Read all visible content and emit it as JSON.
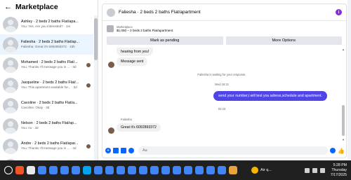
{
  "sidebar": {
    "title": "Marketplace",
    "conversations": [
      {
        "name": "Ashley · 2 beds 2 baths Flat/apa...",
        "preview": "You: Yes. Are you interested? · 1m",
        "active": false,
        "unread_avatar": false
      },
      {
        "name": "Faliesha · 2 beds 2 baths Flat/ap...",
        "preview": "Faliesha: Great it's 6092893372 · 15h",
        "active": true,
        "unread_avatar": false
      },
      {
        "name": "Mohamed · 2 beds 2 baths Flat/...",
        "preview": "You: Thanks I'll message you in ... · 3d",
        "active": false,
        "unread_avatar": true
      },
      {
        "name": "Jacqueline · 2 beds 2 baths Flat/...",
        "preview": "You: This apartment available for... · 3d",
        "active": false,
        "unread_avatar": true
      },
      {
        "name": "Cavoline · 2 beds 2 baths Flat/a...",
        "preview": "Cavoline: Okay · 3d",
        "active": false,
        "unread_avatar": false
      },
      {
        "name": "Nelson · 2 beds 2 baths Flat/ap...",
        "preview": "You: no · 3d",
        "active": false,
        "unread_avatar": false
      },
      {
        "name": "Andre · 2 beds 2 baths Flat/apar...",
        "preview": "You: Thanks I'll message you in ... · 4d",
        "active": false,
        "unread_avatar": true
      },
      {
        "name": "Lorena · 2 beds 2 baths Flat/apa...",
        "preview": "",
        "active": false,
        "unread_avatar": false
      }
    ]
  },
  "chat": {
    "title": "Faliesha · 2 beds 2 baths Flat/apartment",
    "listing": {
      "label": "Marketplace",
      "detail": "$1,050 – 2 beds 2 baths Flat/apartment"
    },
    "actions": {
      "mark_pending": "Mark as pending",
      "more_options": "More Options"
    },
    "messages": {
      "partial_in": "hearing from you!",
      "sent_in": "Message sent",
      "waiting": "Faliesha is waiting for your response.",
      "time_1": "Wed 18:31",
      "out_1": "send your number,i will text you adress,schedule and apartment.",
      "time_2": "02:23",
      "sender": "Faliesha",
      "in_2": "Great it's 6092893372"
    },
    "composer": {
      "placeholder": "Aa"
    }
  },
  "taskbar": {
    "weather": "Air q...",
    "time": "5:28 PM",
    "day": "Thursday",
    "date": "7/17/2025",
    "app_colors": [
      "#f35325",
      "#e8e8e8",
      "#4285f4",
      "#4285f4",
      "#4285f4",
      "#4285f4",
      "#00a4ef",
      "#4285f4",
      "#4285f4",
      "#4285f4",
      "#4285f4",
      "#4285f4",
      "#4285f4",
      "#4285f4",
      "#4285f4",
      "#4285f4",
      "#4285f4",
      "#4285f4",
      "#4285f4",
      "#e8a33d"
    ]
  }
}
